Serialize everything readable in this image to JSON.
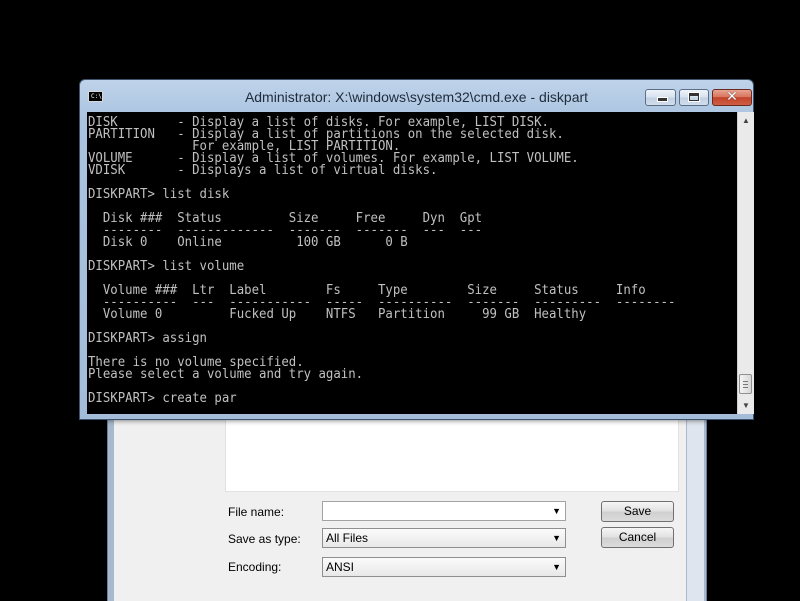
{
  "save_dialog": {
    "file_name_label": "File name:",
    "file_name_value": "",
    "save_as_type_label": "Save as type:",
    "save_as_type_value": "All Files",
    "encoding_label": "Encoding:",
    "encoding_value": "ANSI",
    "save_button": "Save",
    "cancel_button": "Cancel"
  },
  "cmd_window": {
    "title": "Administrator: X:\\windows\\system32\\cmd.exe - diskpart",
    "icon_text": "C:\\",
    "lines": [
      "DISK        - Display a list of disks. For example, LIST DISK.",
      "PARTITION   - Display a list of partitions on the selected disk.",
      "              For example, LIST PARTITION.",
      "VOLUME      - Display a list of volumes. For example, LIST VOLUME.",
      "VDISK       - Displays a list of virtual disks.",
      "",
      "DISKPART> list disk",
      "",
      "  Disk ###  Status         Size     Free     Dyn  Gpt",
      "  --------  -------------  -------  -------  ---  ---",
      "  Disk 0    Online          100 GB      0 B",
      "",
      "DISKPART> list volume",
      "",
      "  Volume ###  Ltr  Label        Fs     Type        Size     Status     Info",
      "  ----------  ---  -----------  -----  ----------  -------  ---------  --------",
      "  Volume 0         Fucked Up    NTFS   Partition     99 GB  Healthy",
      "",
      "DISKPART> assign",
      "",
      "There is no volume specified.",
      "Please select a volume and try again.",
      "",
      "DISKPART> create par"
    ]
  }
}
